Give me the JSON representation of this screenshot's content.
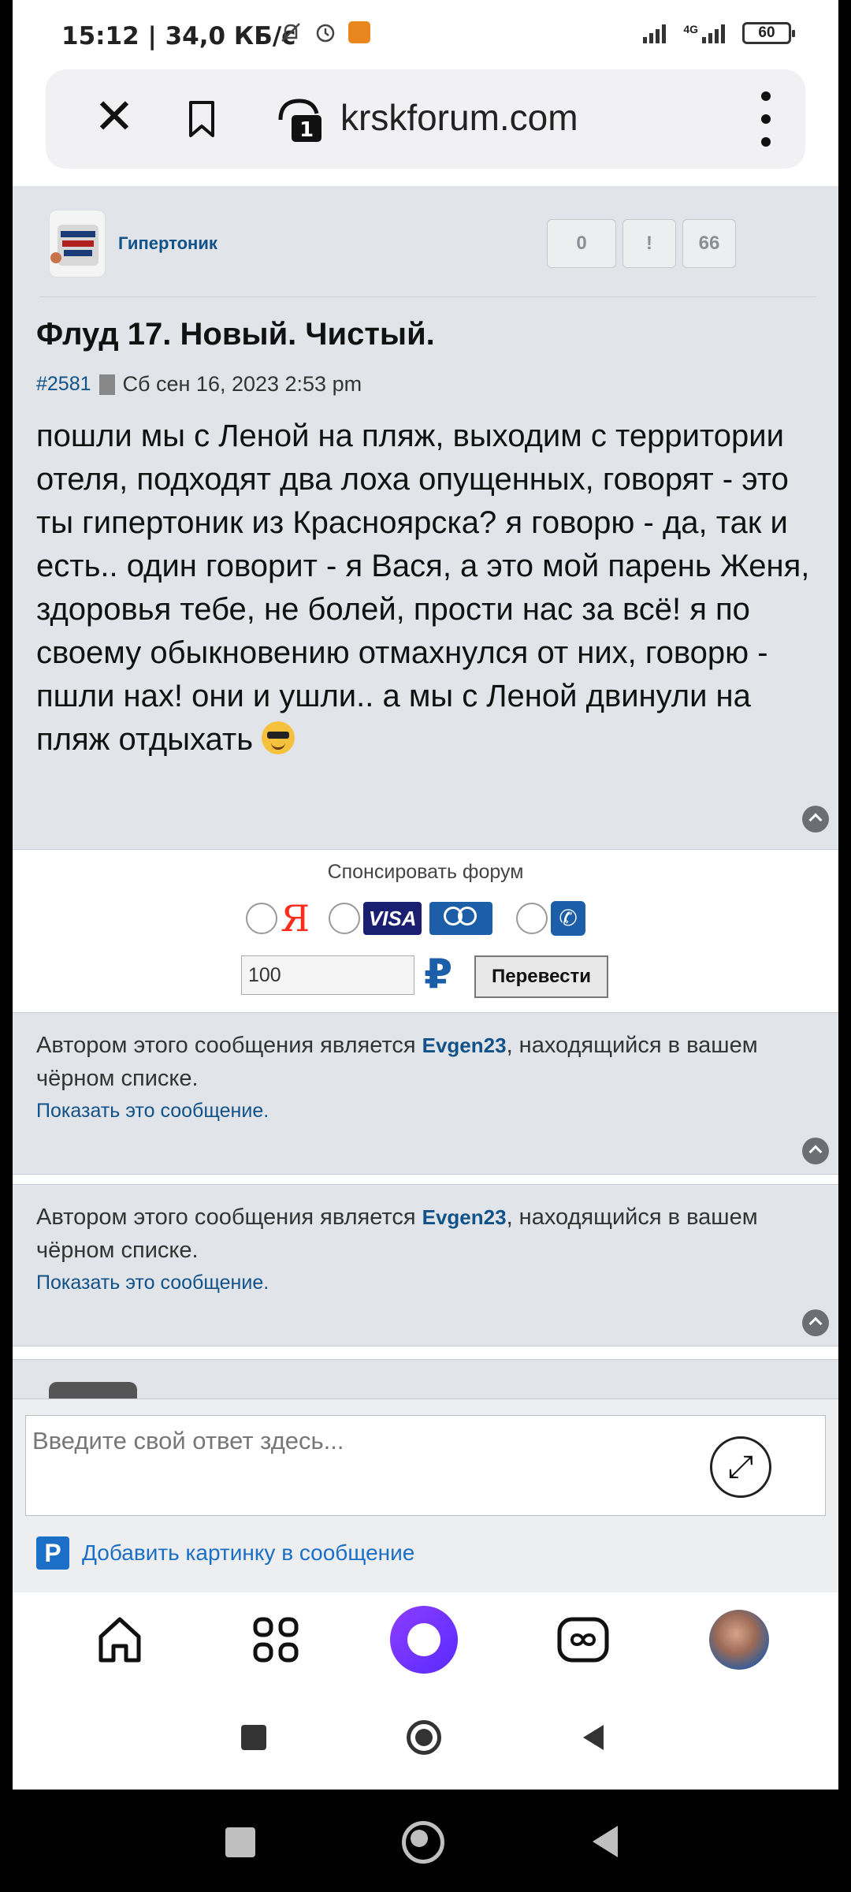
{
  "status_bar": {
    "time": "15:12",
    "speed": "34,0 КБ/с",
    "network": "4G",
    "battery": "60"
  },
  "browser": {
    "domain": "krskforum.com",
    "tab_count": "1",
    "icons": [
      "close-icon",
      "bookmark-icon",
      "lock-tab-icon",
      "more-vert-icon"
    ]
  },
  "post": {
    "author": "Гипертоник",
    "likes": "0",
    "report_label": "!",
    "quote_label": "66",
    "title": "Флуд 17. Новый. Чистый.",
    "number": "#2581",
    "date": "Сб сен 16, 2023 2:53 pm",
    "body": "пошли мы с Леной на пляж, выходим с территории отеля, подходят два лоха опущенных, говорят - это ты гипертоник из Красноярска? я говорю - да, так и есть.. один говорит - я Вася, а это мой парень Женя, здоровья тебе, не болей, прости нас за всё! я по своему обыкновению отмахнулся от них, говорю - пшли нах! они и ушли.. а мы с Леной двинули на пляж отдыхать"
  },
  "sponsor": {
    "label": "Спонсировать форум",
    "ya": "Я",
    "visa": "VISA",
    "amount": "100",
    "currency": "₽",
    "send_button": "Перевести"
  },
  "blocked": [
    {
      "text_before": "Автором этого сообщения является ",
      "user": "Evgen23",
      "text_after": ", находящийся в вашем чёрном списке.",
      "show_link": "Показать это сообщение."
    },
    {
      "text_before": "Автором этого сообщения является ",
      "user": "Evgen23",
      "text_after": ", находящийся в вашем чёрном списке.",
      "show_link": "Показать это сообщение."
    }
  ],
  "reply": {
    "placeholder": "Введите свой ответ здесь...",
    "add_picture": "Добавить картинку в сообщение",
    "add_picture_icon": "P"
  },
  "bottom_nav": [
    "home-icon",
    "apps-grid-icon",
    "alice-assistant-icon",
    "tabs-infinity-icon",
    "profile-avatar"
  ],
  "colors": {
    "link": "#105289",
    "post_bg": "#e1e4e8",
    "accent_purple": "#8c3cff"
  }
}
